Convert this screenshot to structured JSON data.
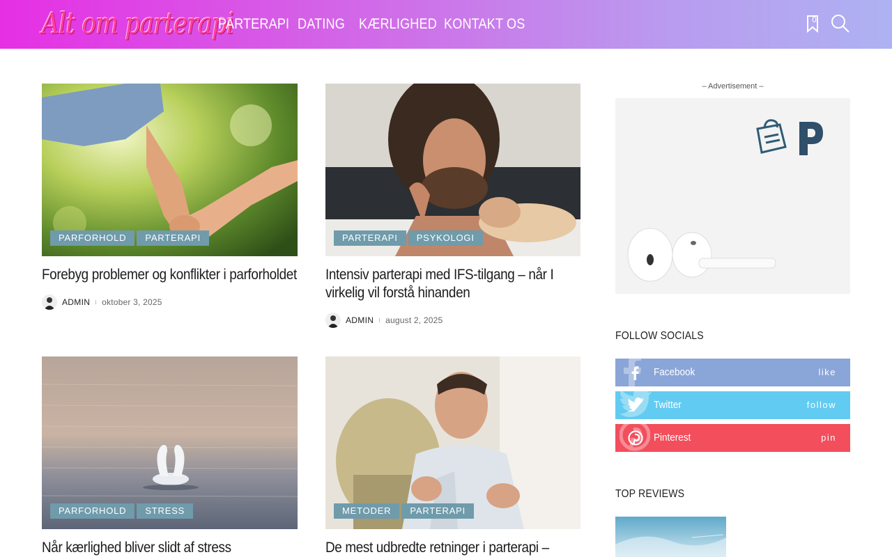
{
  "header": {
    "logo_text": "Alt om parterapi",
    "nav": [
      "PARTERAPI",
      "DATING",
      "KÆRLIGHED",
      "KONTAKT OS"
    ],
    "bookmark_count": "0",
    "colors": {
      "gradient_start": "#e62fe4",
      "gradient_end": "#aeb2f2",
      "logo": "#ff3f9e"
    }
  },
  "articles": [
    {
      "categories": [
        "PARFORHOLD",
        "PARTERAPI"
      ],
      "title": "Forebyg problemer og konflikter i parforholdet",
      "author": "ADMIN",
      "date": "oktober 3, 2025",
      "image_icon": "holding-hands-photo"
    },
    {
      "categories": [
        "PARTERAPI",
        "PSYKOLOGI"
      ],
      "title": "Intensiv parterapi med IFS-tilgang – når I virkelig vil forstå hinanden",
      "author": "ADMIN",
      "date": "august 2, 2025",
      "image_icon": "couple-embrace-photo"
    },
    {
      "categories": [
        "PARFORHOLD",
        "STRESS"
      ],
      "title": "Når kærlighed bliver slidt af stress",
      "author": "",
      "date": "",
      "image_icon": "swans-lake-photo"
    },
    {
      "categories": [
        "METODER",
        "PARTERAPI"
      ],
      "title": "De mest udbredte retninger i parterapi –",
      "author": "",
      "date": "",
      "image_icon": "speaker-man-photo"
    }
  ],
  "sidebar": {
    "ad_label": "– Advertisement –",
    "ad_icon": "earbuds-ad-image",
    "follow_heading": "FOLLOW SOCIALS",
    "socials": [
      {
        "name": "Facebook",
        "action": "like",
        "color": "#8aa5d8",
        "icon": "facebook-icon"
      },
      {
        "name": "Twitter",
        "action": "follow",
        "color": "#62cbf1",
        "icon": "twitter-icon"
      },
      {
        "name": "Pinterest",
        "action": "pin",
        "color": "#f24e5c",
        "icon": "pinterest-icon"
      }
    ],
    "reviews_heading": "TOP REVIEWS"
  }
}
